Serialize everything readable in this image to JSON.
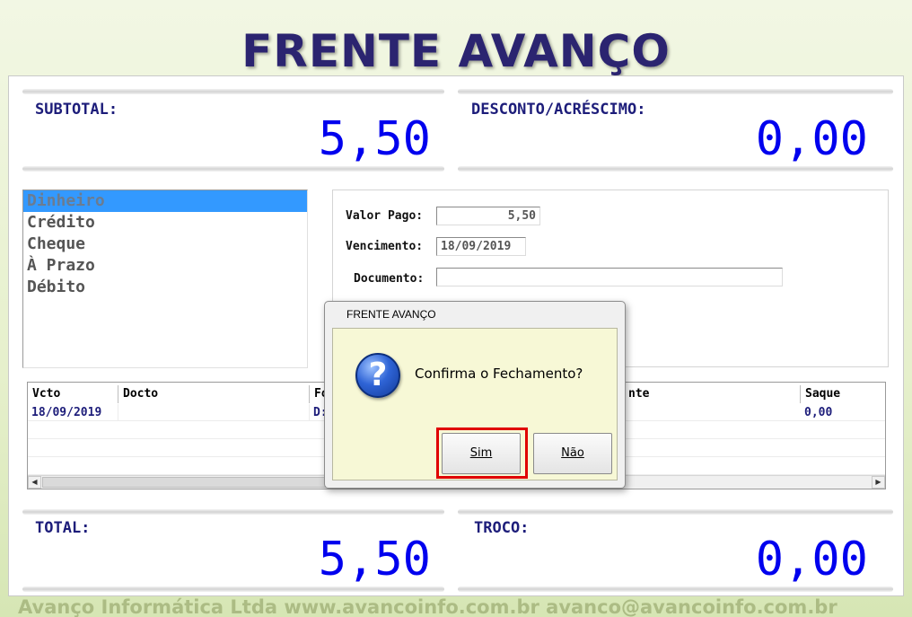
{
  "app_title": "FRENTE AVANÇO",
  "footer_text": "Avanço Informática Ltda   www.avancoinfo.com.br   avanco@avancoinfo.com.br",
  "totals": {
    "subtotal_label": "SUBTOTAL:",
    "subtotal_value": "5,50",
    "discount_label": "DESCONTO/ACRÉSCIMO:",
    "discount_value": "0,00",
    "total_label": "TOTAL:",
    "total_value": "5,50",
    "change_label": "TROCO:",
    "change_value": "0,00"
  },
  "payment_methods": [
    {
      "label": "Dinheiro",
      "selected": true
    },
    {
      "label": "Crédito",
      "selected": false
    },
    {
      "label": "Cheque",
      "selected": false
    },
    {
      "label": "À Prazo",
      "selected": false
    },
    {
      "label": "Débito",
      "selected": false
    }
  ],
  "payment_detail": {
    "valor_pago_label": "Valor Pago:",
    "valor_pago_value": "5,50",
    "vencimento_label": "Vencimento:",
    "vencimento_value": "18/09/2019",
    "documento_label": "Documento:",
    "documento_value": ""
  },
  "installments_grid": {
    "columns": [
      "Vcto",
      "Docto",
      "Fo",
      "nte",
      "Saque"
    ],
    "rows": [
      {
        "vcto": "18/09/2019",
        "docto": "",
        "forma": "D:",
        "saque": "0,00"
      }
    ]
  },
  "dialog": {
    "title": "FRENTE AVANÇO",
    "message": "Confirma o Fechamento?",
    "icon": "question-icon",
    "yes_label": "Sim",
    "no_label": "Não"
  },
  "colors": {
    "value_blue": "#0000ee",
    "label_navy": "#1d1d7a",
    "selection": "#3399ff",
    "highlight": "#e00000",
    "dialog_client": "#f7f8d6"
  }
}
